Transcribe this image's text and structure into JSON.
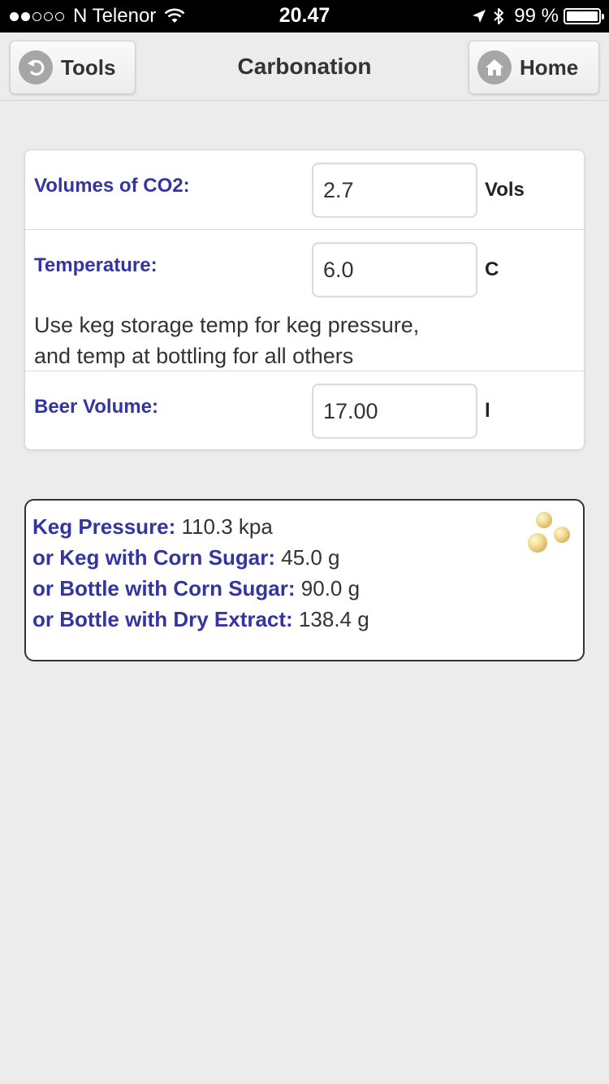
{
  "status_bar": {
    "carrier": "N Telenor",
    "time": "20.47",
    "battery": "99 %",
    "signal_bars": 2,
    "signal_total": 5,
    "battery_level": 0.99
  },
  "nav": {
    "back_label": "Tools",
    "title": "Carbonation",
    "home_label": "Home"
  },
  "form": {
    "volumes": {
      "label": "Volumes of CO2:",
      "value": "2.7",
      "unit": "Vols"
    },
    "temperature": {
      "label": "Temperature:",
      "value": "6.0",
      "unit": "C"
    },
    "hint_line1": "Use keg storage temp for keg pressure,",
    "hint_line2": "and temp at bottling for all others",
    "beer_volume": {
      "label": "Beer Volume:",
      "value": "17.00",
      "unit": "l"
    }
  },
  "results": {
    "keg_pressure": {
      "label": "Keg Pressure:",
      "value": "110.3 kpa"
    },
    "keg_corn_sugar": {
      "label": "or Keg with Corn Sugar:",
      "value": "45.0 g"
    },
    "bottle_corn_sugar": {
      "label": "or Bottle with Corn Sugar:",
      "value": "90.0 g"
    },
    "bottle_dry_extract": {
      "label": "or Bottle with Dry Extract:",
      "value": "138.4 g"
    }
  },
  "colors": {
    "label_blue": "#3535a0",
    "background": "#ececec"
  }
}
